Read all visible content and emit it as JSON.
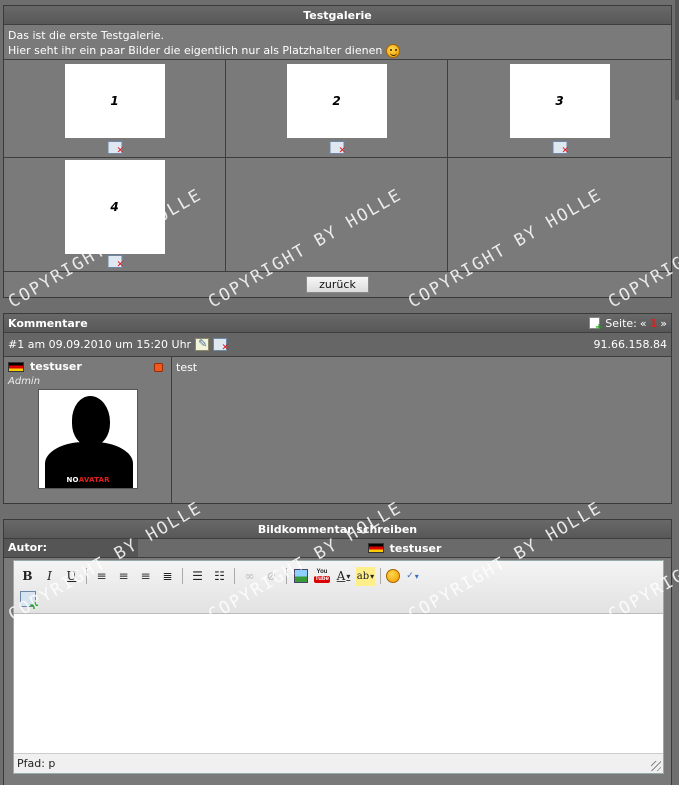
{
  "gallery": {
    "title": "Testgalerie",
    "intro_line1": "Das ist die erste Testgalerie.",
    "intro_line2": "Hier seht ihr ein paar Bilder die eigentlich nur als Platzhalter dienen",
    "images": [
      {
        "label": "1"
      },
      {
        "label": "2"
      },
      {
        "label": "3"
      },
      {
        "label": "4"
      }
    ],
    "back_button": "zurück"
  },
  "comments": {
    "title": "Kommentare",
    "page_label": "Seite:",
    "prev_arrow": "«",
    "current_page": "1",
    "next_arrow": "»",
    "entries": [
      {
        "header": "#1 am 09.09.2010 um 15:20 Uhr",
        "ip": "91.66.158.84",
        "user": "testuser",
        "role": "Admin",
        "avatar_text_a": "NO",
        "avatar_text_b": "AVATAR",
        "text": "test"
      }
    ]
  },
  "editor": {
    "title": "Bildkommentar schreiben",
    "author_label": "Autor:",
    "author_value": "testuser",
    "path_label": "Pfad: p"
  },
  "watermark": "COPYRIGHT BY HOLLE",
  "colors": {
    "background": "#6e6e6e",
    "panel": "#7a7a7a",
    "titlebar": "#5f5f5f",
    "accent_red": "#e02020"
  },
  "icons": {
    "delete": "delete-image-icon",
    "edit": "edit-icon",
    "smiley": "smiley-icon",
    "new_page": "new-page-icon",
    "flag": "flag-germany-icon"
  }
}
